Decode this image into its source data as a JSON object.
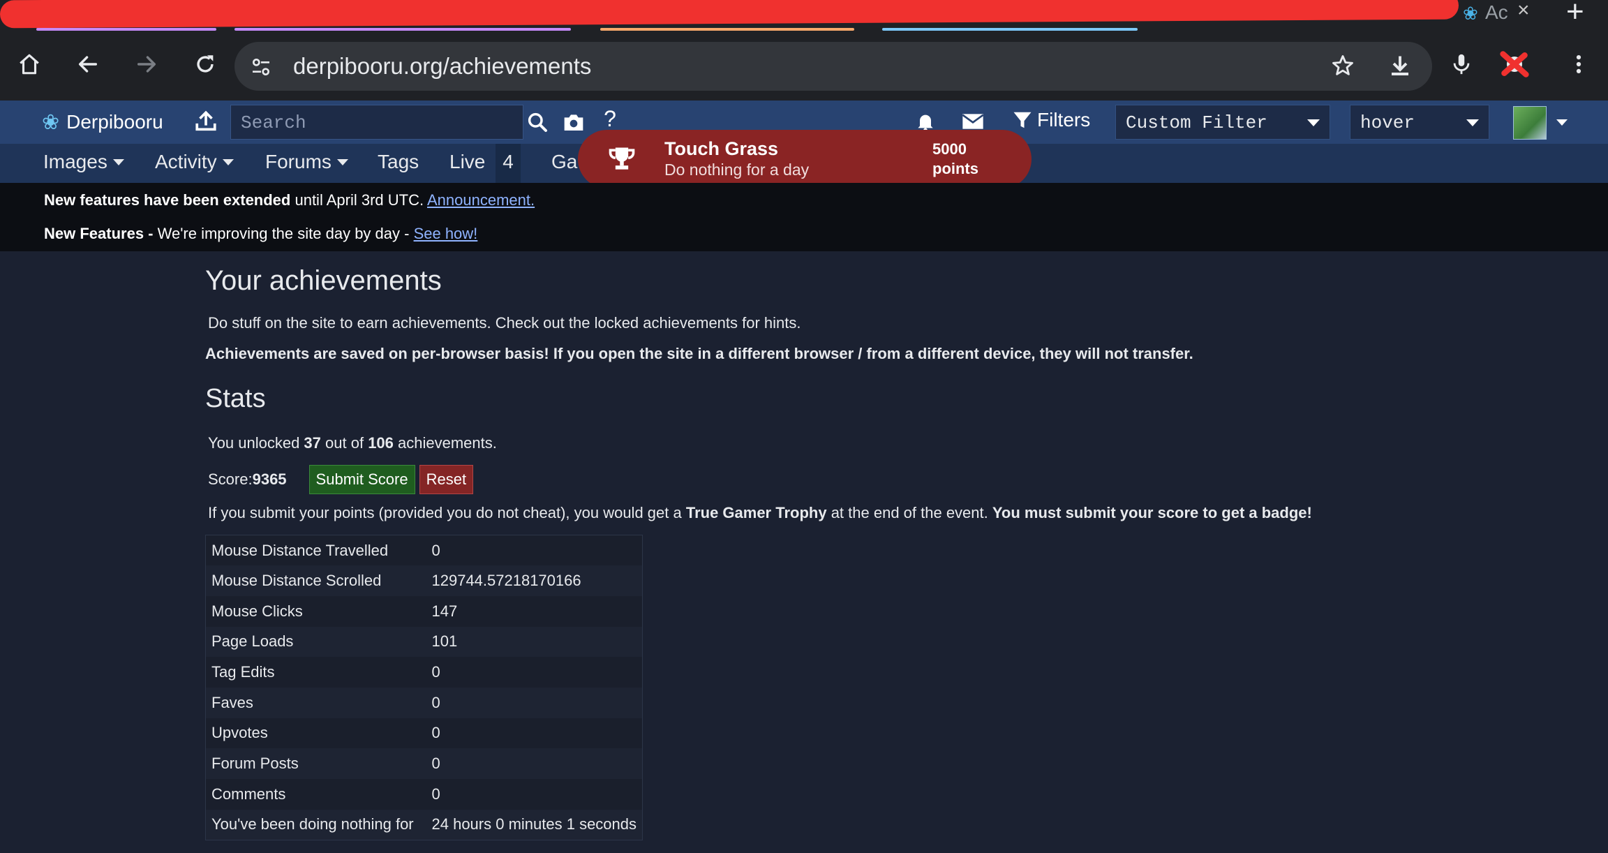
{
  "browser": {
    "active_tab_title": "Ac",
    "url": "derpibooru.org/achievements",
    "new_tab_label": "+"
  },
  "header": {
    "site_name": "Derpibooru",
    "search_placeholder": "Search",
    "help_label": "?",
    "filters_label": "Filters",
    "filter_select": "Custom Filter",
    "hover_select": "hover"
  },
  "nav": {
    "images": "Images",
    "activity": "Activity",
    "forums": "Forums",
    "tags": "Tags",
    "live": "Live",
    "live_count": "4",
    "galleries_partial": "Ga"
  },
  "toast": {
    "title": "Touch Grass",
    "description": "Do nothing for a day",
    "points_value": "5000",
    "points_label": "points"
  },
  "notices": [
    {
      "bold": "New features have been extended",
      "text": " until April 3rd UTC. ",
      "link": "Announcement."
    },
    {
      "bold": "New Features - ",
      "text": "We're improving the site day by day - ",
      "link": "See how!"
    }
  ],
  "page": {
    "title": "Your achievements",
    "intro": "Do stuff on the site to earn achievements. Check out the locked achievements for hints.",
    "warning": "Achievements are saved on per-browser basis! If you open the site in a different browser / from a different device, they will not transfer.",
    "stats_title": "Stats",
    "unlocked_prefix": "You unlocked ",
    "unlocked_count": "37",
    "unlocked_mid": " out of ",
    "unlocked_total": "106",
    "unlocked_suffix": " achievements.",
    "score_label": "Score: ",
    "score_value": "9365",
    "submit_button": "Submit Score",
    "reset_button": "Reset",
    "submit_info_1": "If you submit your points (provided you do not cheat), you would get a ",
    "submit_info_trophy": "True Gamer Trophy",
    "submit_info_2": " at the end of the event. ",
    "submit_info_bold": "You must submit your score to get a badge!"
  },
  "stats": [
    {
      "label": "Mouse Distance Travelled",
      "value": "0"
    },
    {
      "label": "Mouse Distance Scrolled",
      "value": "129744.57218170166"
    },
    {
      "label": "Mouse Clicks",
      "value": "147"
    },
    {
      "label": "Page Loads",
      "value": "101"
    },
    {
      "label": "Tag Edits",
      "value": "0"
    },
    {
      "label": "Faves",
      "value": "0"
    },
    {
      "label": "Upvotes",
      "value": "0"
    },
    {
      "label": "Forum Posts",
      "value": "0"
    },
    {
      "label": "Comments",
      "value": "0"
    },
    {
      "label": "You've been doing nothing for",
      "value": "24 hours 0 minutes 1 seconds"
    }
  ],
  "colors": {
    "header_bg": "#284371",
    "subnav_bg": "#1f3458",
    "toast_bg": "#8a2424",
    "submit_bg": "#1f5d1f",
    "reset_bg": "#842525",
    "link": "#8fb3ff"
  },
  "icons": {
    "home": "home-icon",
    "back": "back-arrow-icon",
    "forward": "forward-arrow-icon",
    "reload": "reload-icon",
    "site_info": "tune-icon",
    "bookmark": "star-icon",
    "download": "download-icon",
    "mic": "microphone-icon",
    "menu": "kebab-menu-icon",
    "upload": "upload-icon",
    "search": "search-icon",
    "camera": "camera-icon",
    "bell": "bell-icon",
    "mail": "envelope-icon",
    "filter": "funnel-icon",
    "trophy": "trophy-icon"
  }
}
